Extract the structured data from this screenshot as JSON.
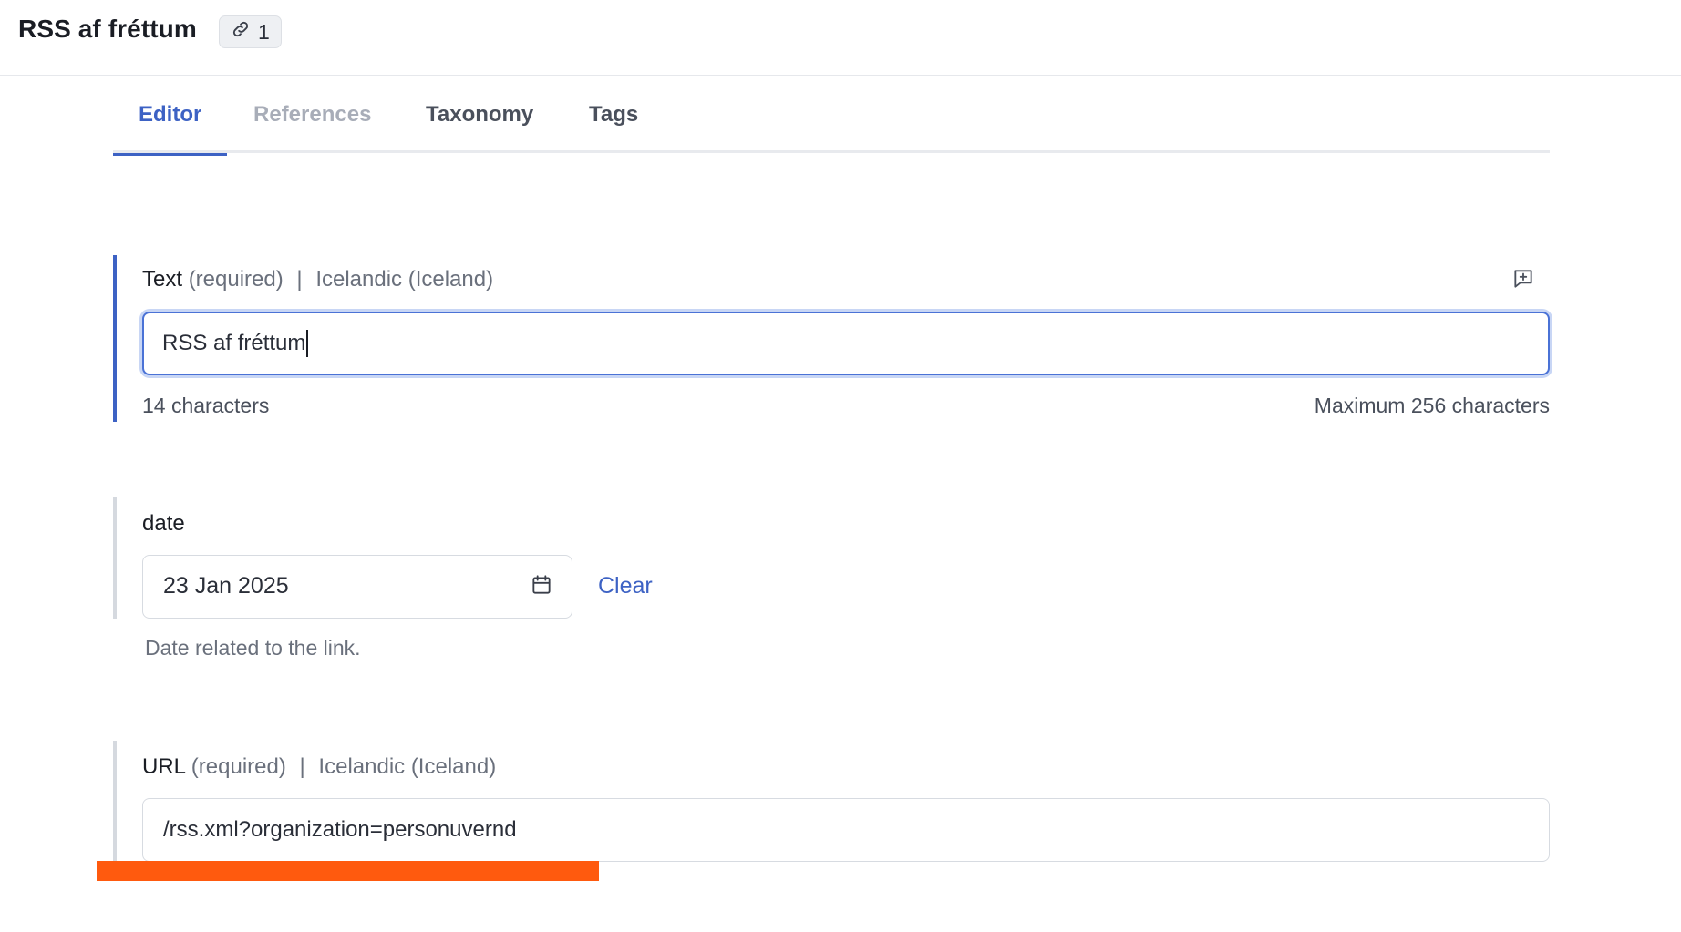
{
  "header": {
    "title": "RSS af fréttum",
    "reference_count": "1",
    "reference_icon": "link-icon"
  },
  "tabs": [
    {
      "label": "Editor",
      "state": "active"
    },
    {
      "label": "References",
      "state": "disabled"
    },
    {
      "label": "Taxonomy",
      "state": "normal"
    },
    {
      "label": "Tags",
      "state": "normal"
    }
  ],
  "fields": {
    "text": {
      "label": "Text",
      "required": "(required)",
      "separator": "|",
      "locale": "Icelandic (Iceland)",
      "value": "RSS af fréttum",
      "char_count": "14 characters",
      "max_chars": "Maximum 256 characters",
      "comment_icon": "add-comment-icon"
    },
    "date": {
      "label": "date",
      "value": "23 Jan 2025",
      "clear_label": "Clear",
      "help": "Date related to the link.",
      "calendar_icon": "calendar-icon"
    },
    "url": {
      "label": "URL",
      "required": "(required)",
      "separator": "|",
      "locale": "Icelandic (Iceland)",
      "value": "/rss.xml?organization=personuvernd"
    }
  },
  "colors": {
    "accent": "#3d62c4",
    "highlight_bar": "#ff5a0e"
  }
}
